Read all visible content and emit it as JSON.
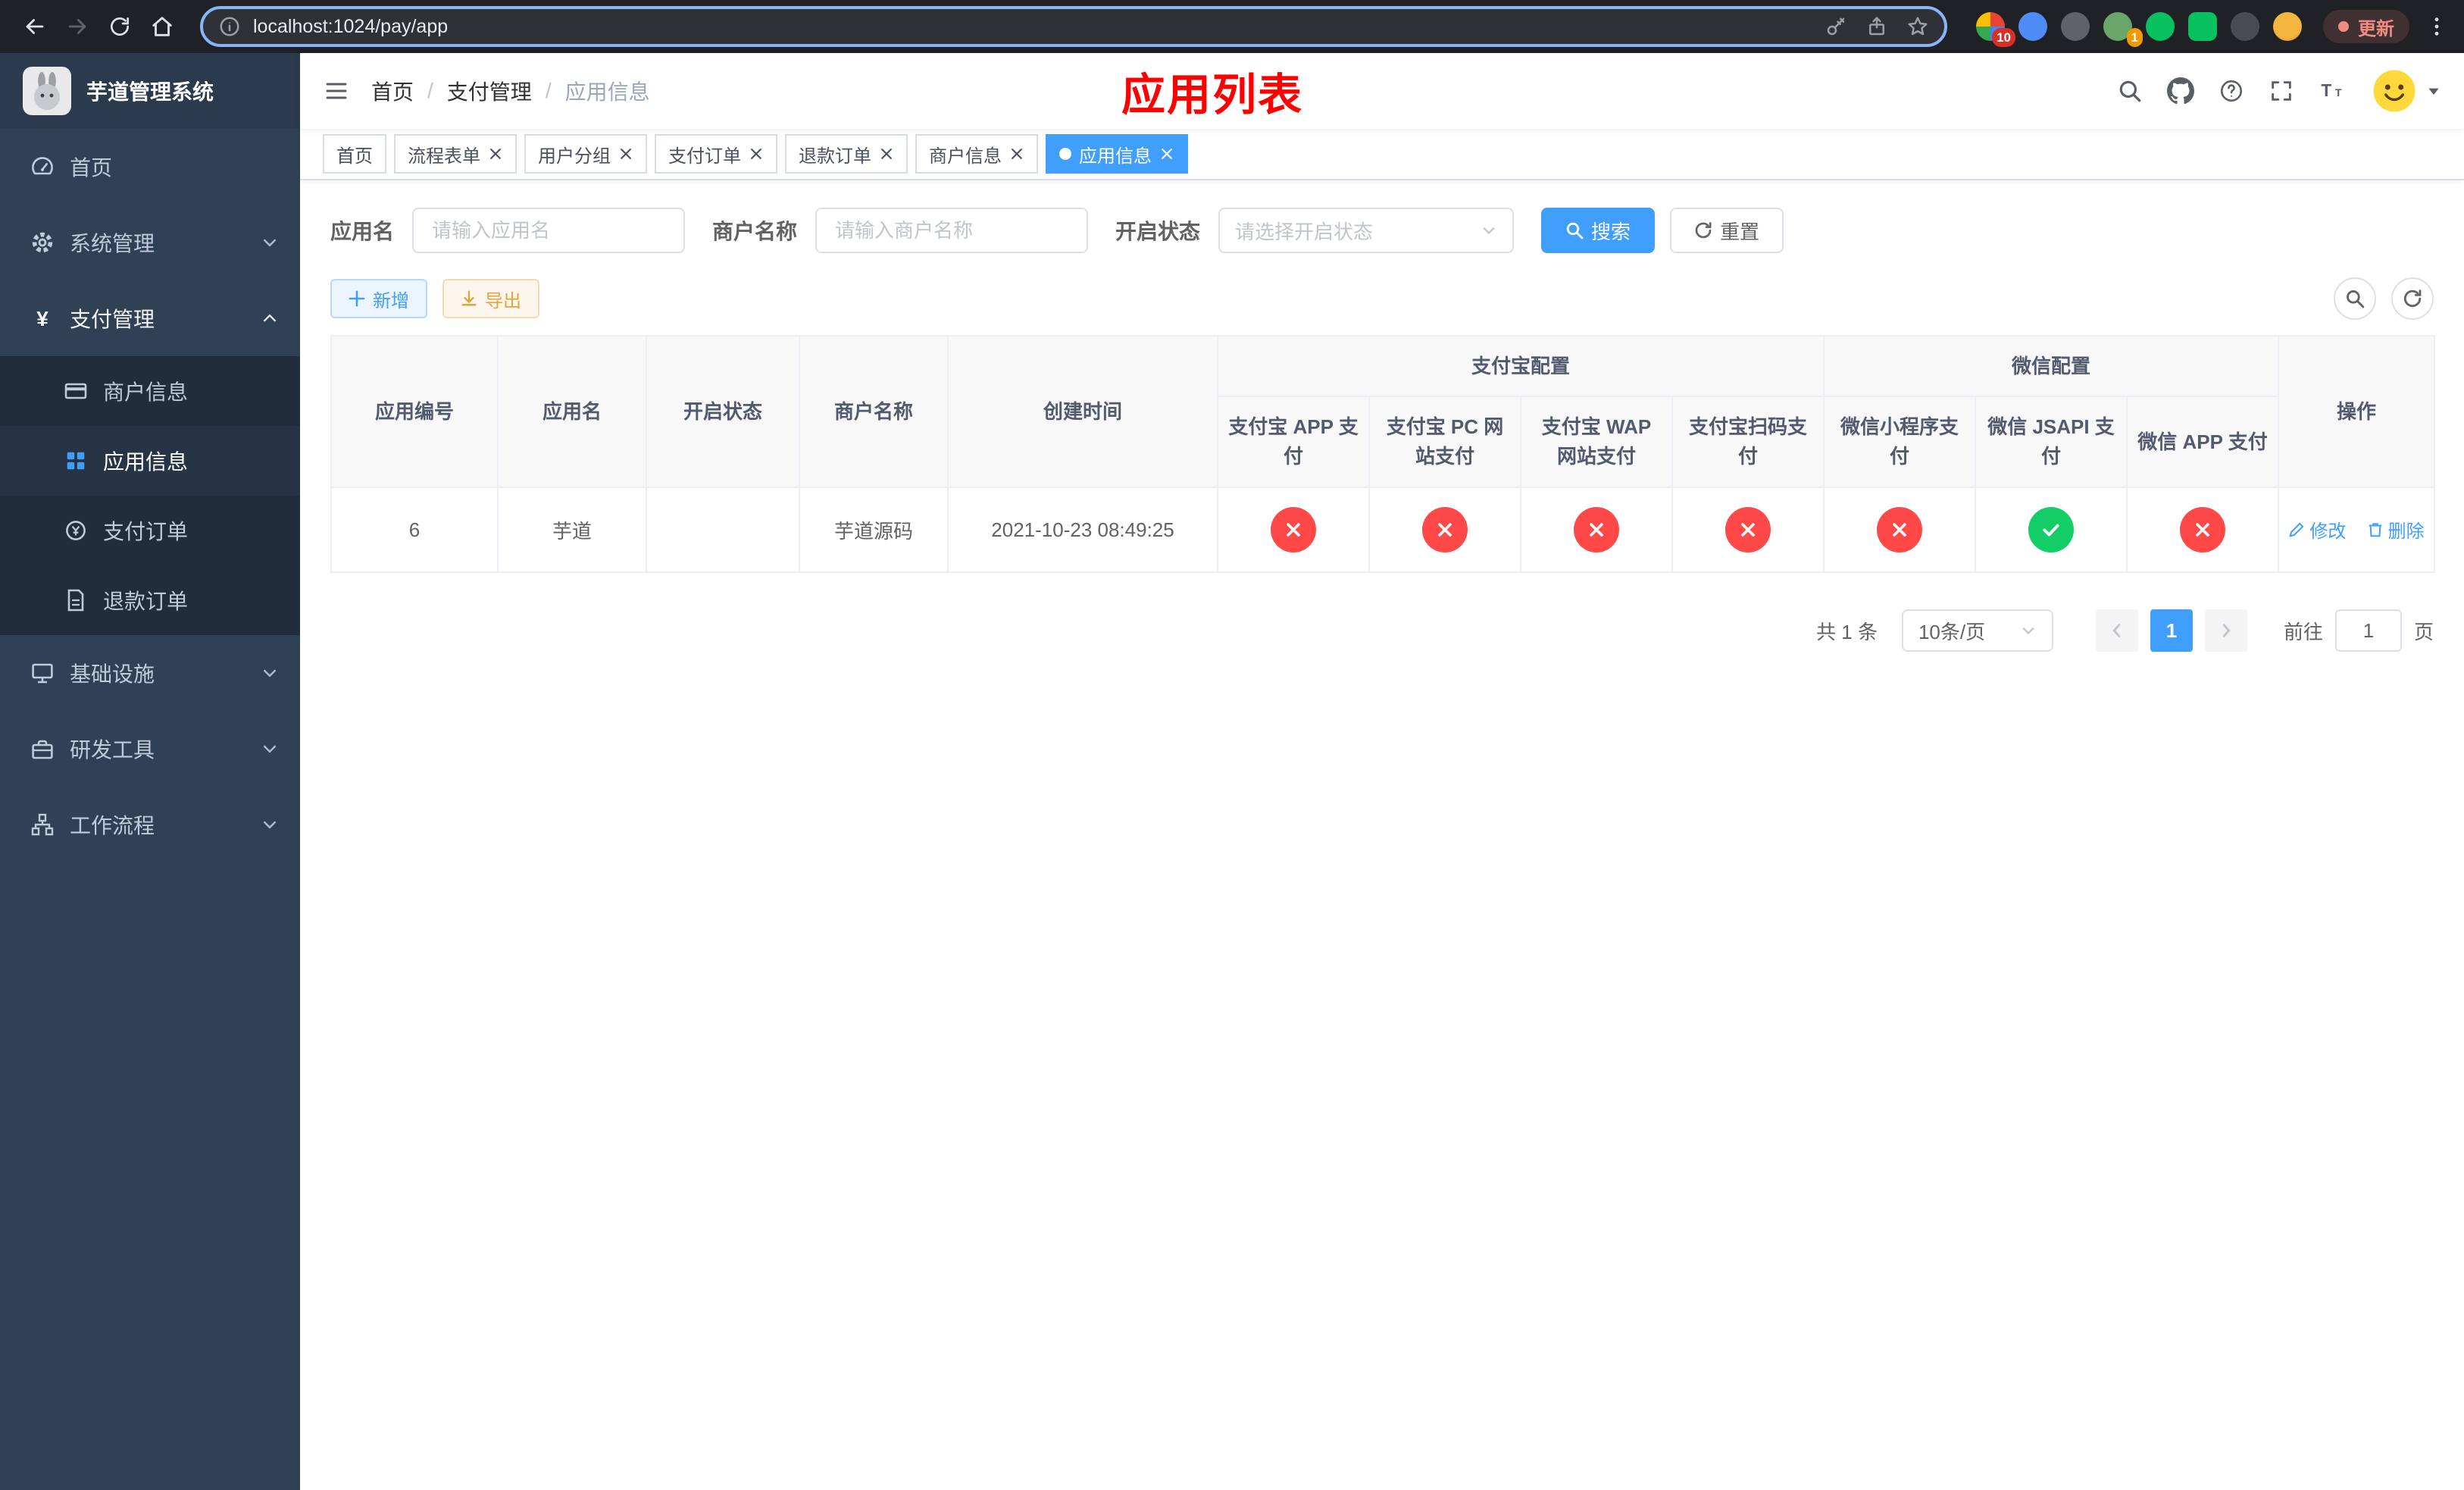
{
  "colors": {
    "primary": "#409EFF",
    "success": "#13ce66",
    "danger": "#ff4949",
    "warning": "#e6a23c",
    "title_red": "#ff0000",
    "sidebar_bg": "#304156",
    "submenu_bg": "#1f2d3d"
  },
  "browser": {
    "url": "localhost:1024/pay/app",
    "update_label": "更新",
    "extension_badge_1": "10",
    "extension_badge_2": "1"
  },
  "sidebar": {
    "app_title": "芋道管理系统",
    "menu": {
      "home": "首页",
      "system": "系统管理",
      "pay": "支付管理",
      "merchant_info": "商户信息",
      "app_info": "应用信息",
      "pay_order": "支付订单",
      "refund_order": "退款订单",
      "infrastructure": "基础设施",
      "dev_tools": "研发工具",
      "workflow": "工作流程"
    }
  },
  "navbar": {
    "breadcrumb": {
      "home": "首页",
      "pay": "支付管理",
      "app_info": "应用信息"
    },
    "page_title": "应用列表"
  },
  "tabs": {
    "home": "首页",
    "flow_form": "流程表单",
    "user_group": "用户分组",
    "pay_order": "支付订单",
    "refund_order": "退款订单",
    "merchant_info": "商户信息",
    "app_info": "应用信息"
  },
  "filter": {
    "app_name_label": "应用名",
    "app_name_placeholder": "请输入应用名",
    "merchant_label": "商户名称",
    "merchant_placeholder": "请输入商户名称",
    "status_label": "开启状态",
    "status_placeholder": "请选择开启状态",
    "search_label": "搜索",
    "reset_label": "重置"
  },
  "toolbar": {
    "add_label": "新增",
    "export_label": "导出"
  },
  "table": {
    "headers": {
      "app_id": "应用编号",
      "app_name": "应用名",
      "status": "开启状态",
      "merchant_name": "商户名称",
      "create_time": "创建时间",
      "alipay_group": "支付宝配置",
      "alipay_app": "支付宝 APP 支付",
      "alipay_pc": "支付宝 PC 网站支付",
      "alipay_wap": "支付宝 WAP 网站支付",
      "alipay_qr": "支付宝扫码支付",
      "wechat_group": "微信配置",
      "wechat_mini": "微信小程序支付",
      "wechat_jsapi": "微信 JSAPI 支付",
      "wechat_app": "微信 APP 支付",
      "actions": "操作"
    },
    "row": {
      "app_id": "6",
      "app_name": "芋道",
      "status_enabled": true,
      "merchant_name": "芋道源码",
      "create_time": "2021-10-23 08:49:25",
      "channels": {
        "alipay_app": false,
        "alipay_pc": false,
        "alipay_wap": false,
        "alipay_qr": false,
        "wechat_mini": false,
        "wechat_jsapi": true,
        "wechat_app": false
      },
      "edit_label": "修改",
      "delete_label": "删除"
    }
  },
  "pagination": {
    "total_label": "共 1 条",
    "page_size_label": "10条/页",
    "page_number": "1",
    "goto_label": "前往",
    "goto_value": "1",
    "page_unit_label": "页"
  },
  "icons": {
    "browser": [
      "back-icon",
      "forward-icon",
      "reload-icon",
      "home-icon",
      "site-info-icon",
      "key-icon",
      "share-icon",
      "bookmark-star-icon",
      "more-menu-icon"
    ],
    "navbar": [
      "hamburger-icon",
      "search-icon",
      "github-icon",
      "help-icon",
      "fullscreen-icon",
      "font-size-icon",
      "caret-down-icon"
    ],
    "status_pass": "check-circle",
    "status_fail": "cross-circle"
  }
}
